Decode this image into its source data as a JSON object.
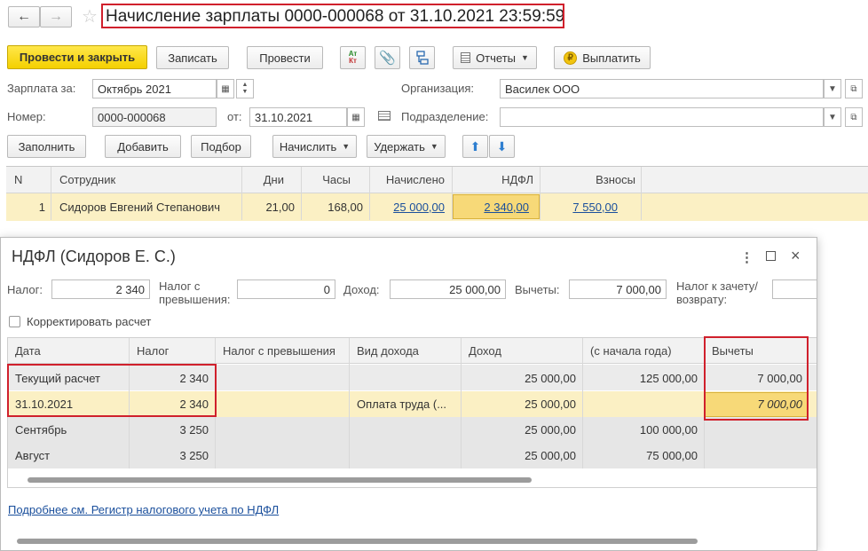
{
  "window": {
    "title": "Начисление зарплаты 0000-000068 от 31.10.2021 23:59:59"
  },
  "toolbar": {
    "post_close": "Провести и закрыть",
    "save": "Записать",
    "post": "Провести",
    "reports": "Отчеты",
    "pay": "Выплатить",
    "dtkt_top": "Ат",
    "dtkt_bottom": "Кт"
  },
  "form": {
    "salary_for_label": "Зарплата за:",
    "salary_for_value": "Октябрь 2021",
    "org_label": "Организация:",
    "org_value": "Василек ООО",
    "number_label": "Номер:",
    "number_value": "0000-000068",
    "from_label": "от:",
    "date_value": "31.10.2021",
    "dept_label": "Подразделение:",
    "dept_value": ""
  },
  "actions": {
    "fill": "Заполнить",
    "add": "Добавить",
    "select": "Подбор",
    "accrue": "Начислить",
    "withhold": "Удержать"
  },
  "main_table": {
    "headers": [
      "N",
      "Сотрудник",
      "Дни",
      "Часы",
      "Начислено",
      "НДФЛ",
      "Взносы"
    ],
    "row": {
      "n": "1",
      "employee": "Сидоров Евгений Степанович",
      "days": "21,00",
      "hours": "168,00",
      "accrued": "25 000,00",
      "ndfl": "2 340,00",
      "contrib": "7 550,00"
    }
  },
  "dialog": {
    "title": "НДФЛ (Сидоров Е. С.)",
    "tax_label": "Налог:",
    "tax_value": "2 340",
    "excess_label_1": "Налог с",
    "excess_label_2": "превышения:",
    "excess_value": "0",
    "income_label": "Доход:",
    "income_value": "25 000,00",
    "deductions_label": "Вычеты:",
    "deductions_value": "7 000,00",
    "offset_label_1": "Налог к зачету/",
    "offset_label_2": "возврату:",
    "offset_value": "",
    "correct_label": "Корректировать расчет",
    "headers": [
      "Дата",
      "Налог",
      "Налог с превышения",
      "Вид дохода",
      "Доход",
      "(с начала года)",
      "Вычеты"
    ],
    "rows": [
      {
        "date": "Текущий расчет",
        "tax": "2 340",
        "excess": "",
        "kind": "",
        "income": "25 000,00",
        "ytd": "125 000,00",
        "deduct": "7 000,00"
      },
      {
        "date": "31.10.2021",
        "tax": "2 340",
        "excess": "",
        "kind": "Оплата труда (...",
        "income": "25 000,00",
        "ytd": "",
        "deduct": "7 000,00"
      },
      {
        "date": "Сентябрь",
        "tax": "3 250",
        "excess": "",
        "kind": "",
        "income": "25 000,00",
        "ytd": "100 000,00",
        "deduct": ""
      },
      {
        "date": "Август",
        "tax": "3 250",
        "excess": "",
        "kind": "",
        "income": "25 000,00",
        "ytd": "75 000,00",
        "deduct": ""
      }
    ],
    "footer_link": "Подробнее см. Регистр налогового учета по НДФЛ"
  }
}
